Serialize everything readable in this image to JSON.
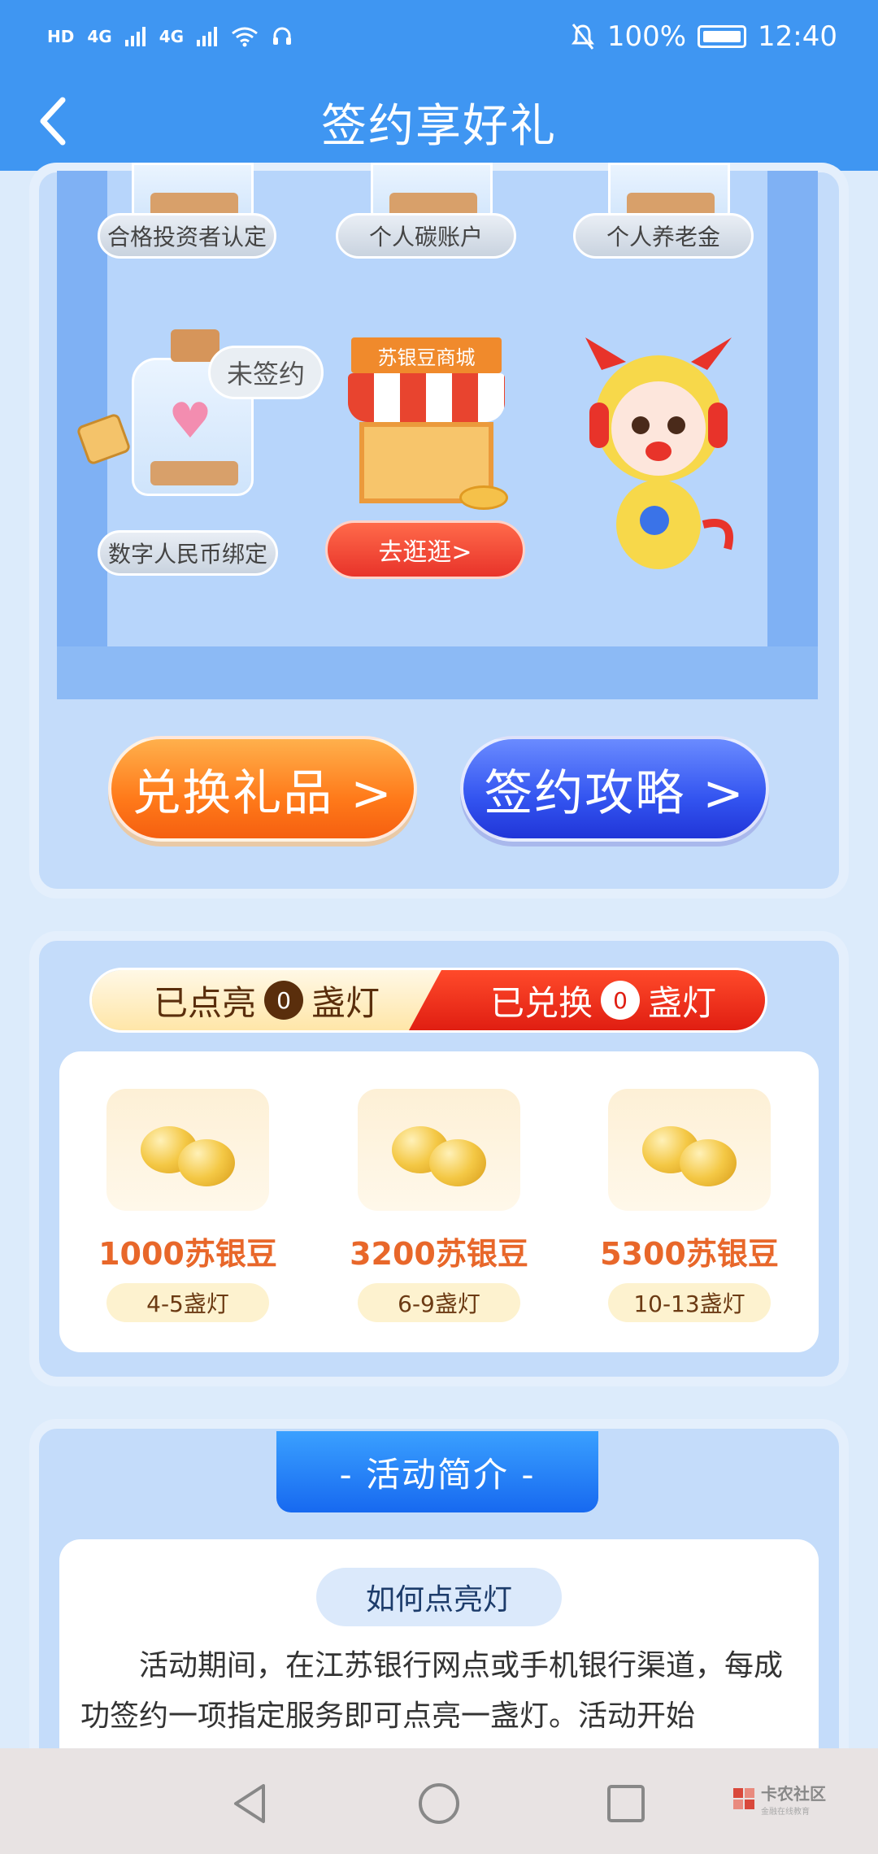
{
  "status_bar": {
    "network": [
      "HD",
      "4G",
      "4G"
    ],
    "battery": "100%",
    "time": "12:40"
  },
  "nav": {
    "title": "签约享好礼"
  },
  "showcase": {
    "jars_top": [
      "合格投资者认定",
      "个人碳账户",
      "个人养老金"
    ],
    "jar_bottom_label": "数字人民币绑定",
    "bubble": "未签约",
    "store_sign": "苏银豆商城",
    "go_button": "去逛逛>"
  },
  "actions": {
    "exchange": "兑换礼品 >",
    "guide": "签约攻略 >"
  },
  "lamps": {
    "lit_prefix": "已点亮",
    "lit_count": "0",
    "lit_suffix": "盏灯",
    "redeemed_prefix": "已兑换",
    "redeemed_count": "0",
    "redeemed_suffix": "盏灯",
    "rewards": [
      {
        "amount": "1000苏银豆",
        "need": "4-5盏灯"
      },
      {
        "amount": "3200苏银豆",
        "need": "6-9盏灯"
      },
      {
        "amount": "5300苏银豆",
        "need": "10-13盏灯"
      }
    ]
  },
  "intro": {
    "heading": "- 活动简介 -",
    "subheading": "如何点亮灯",
    "text": "活动期间，在江苏银行网点或手机银行渠道，每成功签约一项指定服务即可点亮一盏灯。活动开始"
  },
  "watermark": {
    "title": "卡农社区",
    "sub": "金融在线教育"
  },
  "colors": {
    "primary": "#3f96f2",
    "orange": "#ff7a1a",
    "blue": "#3354f0",
    "red": "#e01e12"
  }
}
